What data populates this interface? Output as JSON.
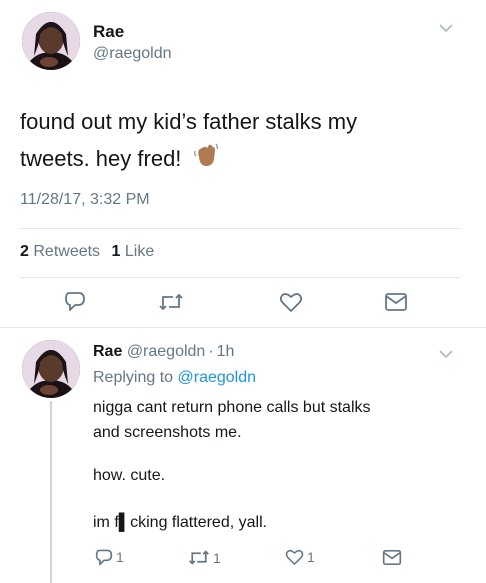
{
  "main_tweet": {
    "display_name": "Rae",
    "handle": "@raegoldn",
    "text": "found out my kid’s father stalks my tweets. hey fred!",
    "emoji": "waving-hand-emoji",
    "timestamp": "11/28/17, 3:32 PM",
    "retweets_count": "2",
    "retweets_label": "Retweets",
    "likes_count": "1",
    "likes_label": "Like"
  },
  "reply_tweet": {
    "display_name": "Rae",
    "handle": "@raegoldn",
    "separator": "·",
    "time_ago": "1h",
    "replying_label": "Replying to",
    "replying_handle": "@raegoldn",
    "lines": [
      "nigga cant return phone calls but stalks",
      "and screenshots me."
    ],
    "line2": "how. cute.",
    "line3": "im f▌cking flattered, yall.",
    "reply_count": "1",
    "retweet_count": "1",
    "like_count": "1"
  },
  "colors": {
    "accent": "#1b95e0",
    "muted": "#657786",
    "divider": "#e1e8ed",
    "icon": "#657786"
  }
}
